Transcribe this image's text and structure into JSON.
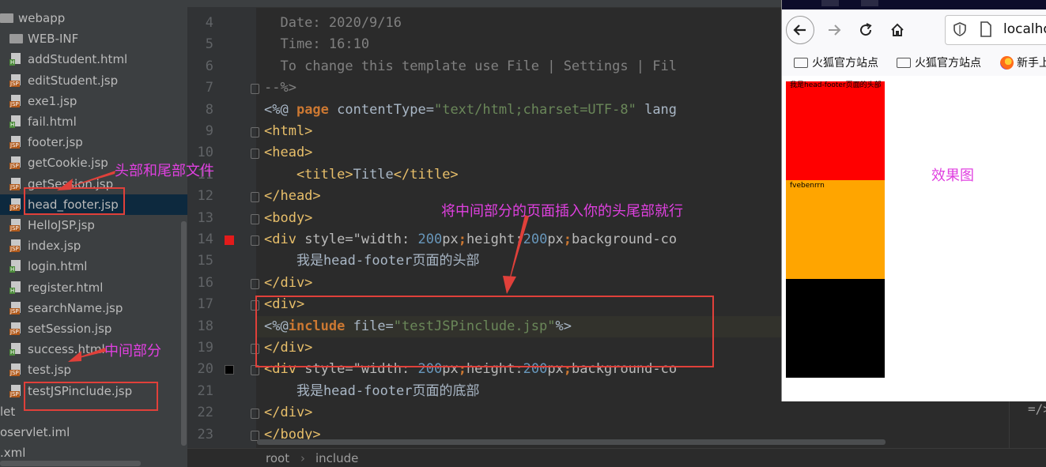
{
  "project_tree": {
    "items": [
      {
        "label": "webapp",
        "kind": "folder"
      },
      {
        "label": "WEB-INF",
        "kind": "folder"
      },
      {
        "label": "addStudent.html",
        "kind": "html"
      },
      {
        "label": "editStudent.jsp",
        "kind": "jsp"
      },
      {
        "label": "exe1.jsp",
        "kind": "jsp"
      },
      {
        "label": "fail.html",
        "kind": "html"
      },
      {
        "label": "footer.jsp",
        "kind": "jsp"
      },
      {
        "label": "getCookie.jsp",
        "kind": "jsp"
      },
      {
        "label": "getSession.jsp",
        "kind": "jsp"
      },
      {
        "label": "head_footer.jsp",
        "kind": "jsp",
        "selected": true
      },
      {
        "label": "HelloJSP.jsp",
        "kind": "jsp"
      },
      {
        "label": "index.jsp",
        "kind": "jsp"
      },
      {
        "label": "login.html",
        "kind": "html"
      },
      {
        "label": "register.html",
        "kind": "html"
      },
      {
        "label": "searchName.jsp",
        "kind": "jsp"
      },
      {
        "label": "setSession.jsp",
        "kind": "jsp"
      },
      {
        "label": "success.html",
        "kind": "html"
      },
      {
        "label": "test.jsp",
        "kind": "jsp"
      },
      {
        "label": "testJSPinclude.jsp",
        "kind": "jsp"
      },
      {
        "label": "let",
        "kind": "none"
      },
      {
        "label": "oservlet.iml",
        "kind": "none"
      },
      {
        "label": ".xml",
        "kind": "none"
      }
    ]
  },
  "editor": {
    "line_numbers": [
      "4",
      "5",
      "6",
      "7",
      "8",
      "9",
      "10",
      "11",
      "12",
      "13",
      "14",
      "15",
      "16",
      "17",
      "18",
      "19",
      "20",
      "21",
      "22",
      "23"
    ],
    "lines": [
      {
        "segs": [
          {
            "t": "  Date: 2020/9/16",
            "c": "cm"
          }
        ]
      },
      {
        "segs": [
          {
            "t": "  Time: 16:10",
            "c": "cm"
          }
        ]
      },
      {
        "segs": [
          {
            "t": "  To change this template use File | Settings | Fil",
            "c": "cm"
          }
        ]
      },
      {
        "segs": [
          {
            "t": "--%>",
            "c": "cm"
          }
        ]
      },
      {
        "segs": [
          {
            "t": "<%@ ",
            "c": "plain"
          },
          {
            "t": "page",
            "c": "kw"
          },
          {
            "t": " contentType=",
            "c": "plain"
          },
          {
            "t": "\"text/html;charset=UTF-8\"",
            "c": "str"
          },
          {
            "t": " lang",
            "c": "plain"
          }
        ]
      },
      {
        "segs": [
          {
            "t": "<html>",
            "c": "tag"
          }
        ]
      },
      {
        "segs": [
          {
            "t": "<head>",
            "c": "tag"
          }
        ]
      },
      {
        "segs": [
          {
            "t": "    <title>",
            "c": "tag"
          },
          {
            "t": "Title",
            "c": "plain"
          },
          {
            "t": "</title>",
            "c": "tag"
          }
        ]
      },
      {
        "segs": [
          {
            "t": "</head>",
            "c": "tag"
          }
        ]
      },
      {
        "segs": [
          {
            "t": "<body>",
            "c": "tag"
          }
        ]
      },
      {
        "segs": [
          {
            "t": "<div ",
            "c": "tag"
          },
          {
            "t": "style=\"width: ",
            "c": "attr"
          },
          {
            "t": "200",
            "c": "num"
          },
          {
            "t": "px",
            "c": "attr"
          },
          {
            "t": ";",
            "c": "kw"
          },
          {
            "t": "height:",
            "c": "attr"
          },
          {
            "t": "200",
            "c": "num"
          },
          {
            "t": "px",
            "c": "attr"
          },
          {
            "t": ";",
            "c": "kw"
          },
          {
            "t": "background-co",
            "c": "attr"
          }
        ]
      },
      {
        "segs": [
          {
            "t": "    我是head-footer页面的头部",
            "c": "plain"
          }
        ]
      },
      {
        "segs": [
          {
            "t": "</div>",
            "c": "tag"
          }
        ]
      },
      {
        "segs": [
          {
            "t": "<div>",
            "c": "tag"
          }
        ]
      },
      {
        "segs": [
          {
            "t": "<%@",
            "c": "plain"
          },
          {
            "t": "include",
            "c": "kw"
          },
          {
            "t": " file=",
            "c": "plain"
          },
          {
            "t": "\"testJSPinclude.jsp\"",
            "c": "str"
          },
          {
            "t": "%>",
            "c": "plain"
          }
        ]
      },
      {
        "segs": [
          {
            "t": "</div>",
            "c": "tag"
          }
        ]
      },
      {
        "segs": [
          {
            "t": "<div ",
            "c": "tag"
          },
          {
            "t": "style=\"width: ",
            "c": "attr"
          },
          {
            "t": "200",
            "c": "num"
          },
          {
            "t": "px",
            "c": "attr"
          },
          {
            "t": ";",
            "c": "kw"
          },
          {
            "t": "height:",
            "c": "attr"
          },
          {
            "t": "200",
            "c": "num"
          },
          {
            "t": "px",
            "c": "attr"
          },
          {
            "t": ";",
            "c": "kw"
          },
          {
            "t": "background-co",
            "c": "attr"
          }
        ]
      },
      {
        "segs": [
          {
            "t": "    我是head-footer页面的底部",
            "c": "plain"
          }
        ]
      },
      {
        "segs": [
          {
            "t": "</div>",
            "c": "tag"
          }
        ]
      },
      {
        "segs": [
          {
            "t": "</body>",
            "c": "tag"
          }
        ]
      }
    ],
    "breadcrumb": [
      "root",
      "include"
    ],
    "breadcrumb_sep": "›",
    "right_snippet": "=/>"
  },
  "browser": {
    "url": "localho",
    "bookmarks": [
      "火狐官方站点",
      "火狐官方站点",
      "新手上"
    ],
    "header_text": "我是head-footer页面的头部",
    "middle_text": "fvebenrrn",
    "colors": {
      "header": "#ff0000",
      "middle": "#ffa500",
      "footer": "#000000"
    }
  },
  "annotations": {
    "head_footer_note": "头部和尾部文件",
    "middle_note": "中间部分",
    "insert_note": "将中间部分的页面插入你的头尾部就行",
    "result_note": "效果图"
  }
}
